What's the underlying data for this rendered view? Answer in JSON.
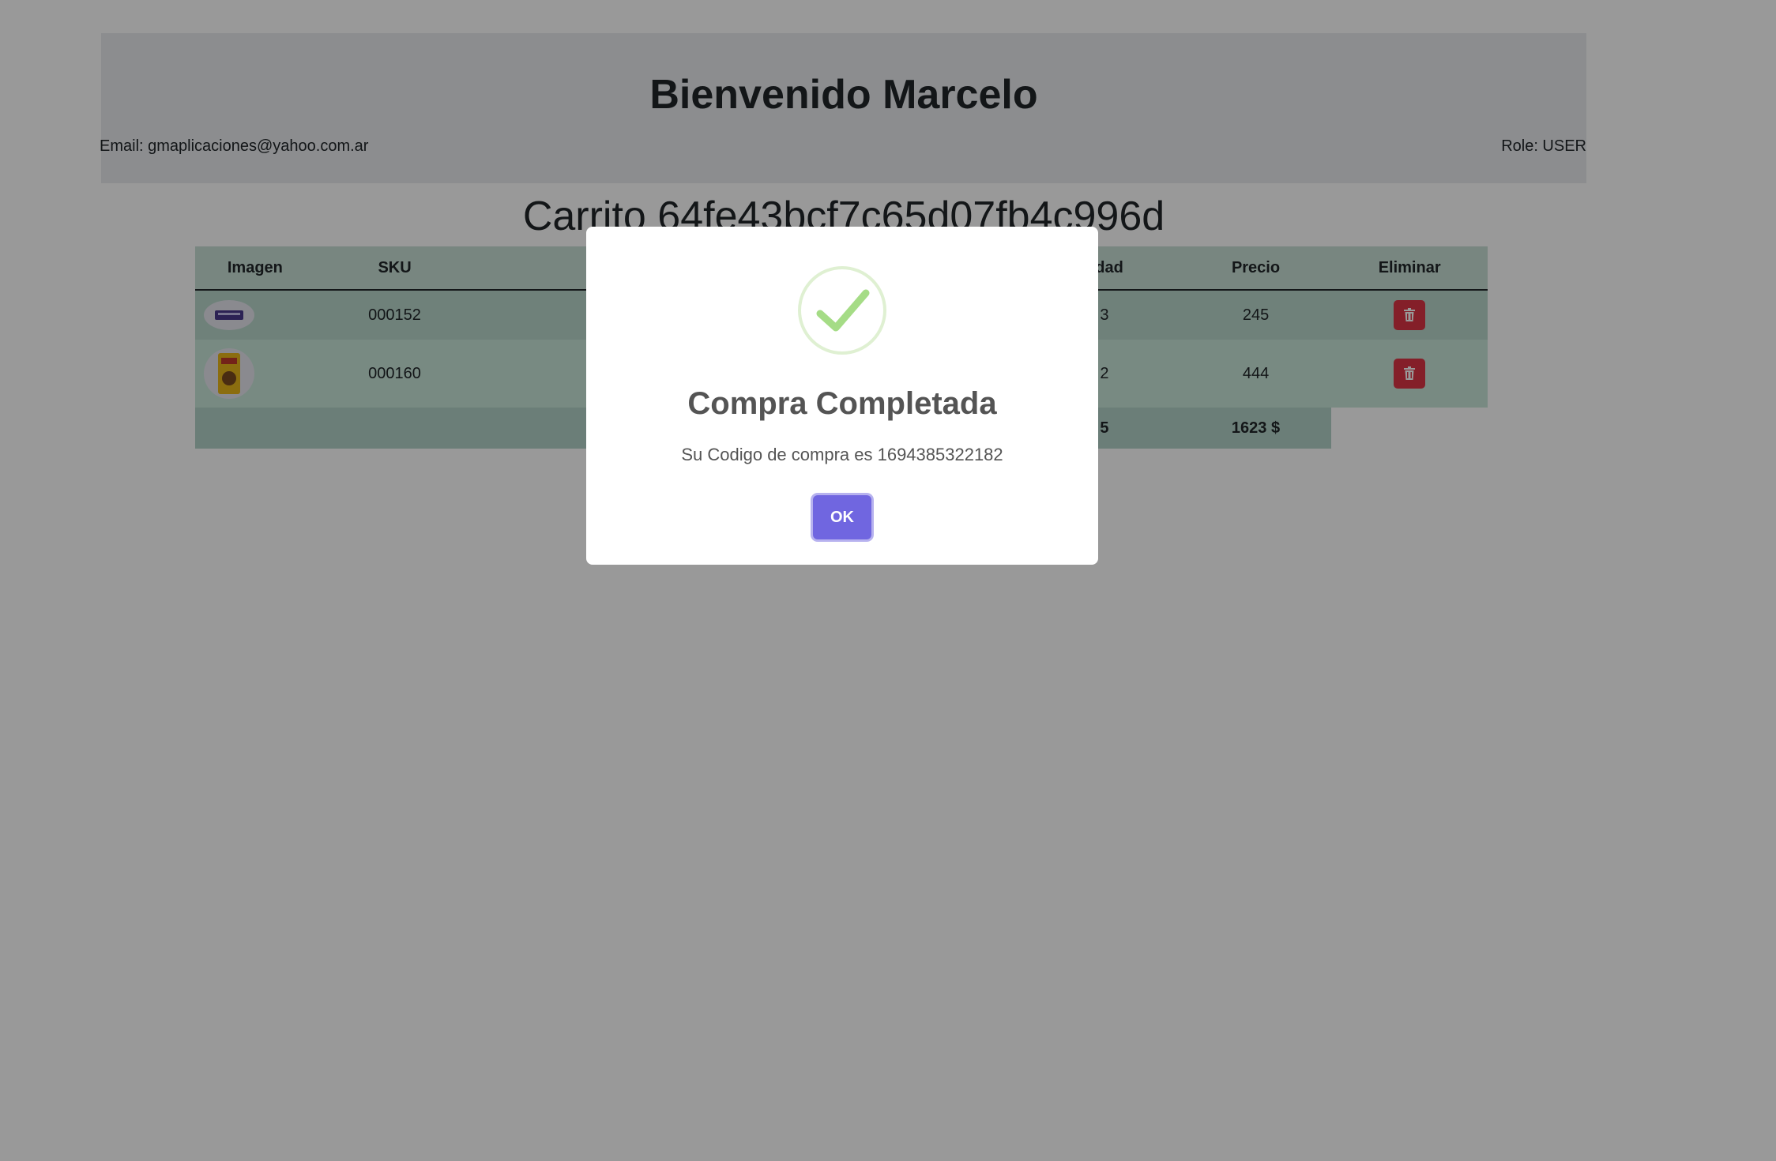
{
  "header": {
    "welcome": "Bienvenido Marcelo",
    "email": "Email: gmaplicaciones@yahoo.com.ar",
    "role": "Role: USER"
  },
  "cart": {
    "title": "Carrito 64fe43bcf7c65d07fb4c996d",
    "columns": [
      "Imagen",
      "SKU",
      "",
      "",
      "tidad",
      "Precio",
      "Eliminar"
    ],
    "rows": [
      {
        "sku": "000152",
        "cantidad": "3",
        "precio": "245"
      },
      {
        "sku": "000160",
        "cantidad": "2",
        "precio": "444"
      }
    ],
    "total_cantidad": "5",
    "total_precio": "1623 $"
  },
  "modal": {
    "title": "Compra Completada",
    "text": "Su Codigo de compra es 1694385322182",
    "ok_label": "OK"
  },
  "colors": {
    "overlay": "rgba(0,0,0,0.4)",
    "ok_button": "#7066e0",
    "delete_button": "#dc3545",
    "success_check": "#a5dc86"
  },
  "icons": [
    "success-check-icon",
    "trash-icon",
    "product-image"
  ]
}
